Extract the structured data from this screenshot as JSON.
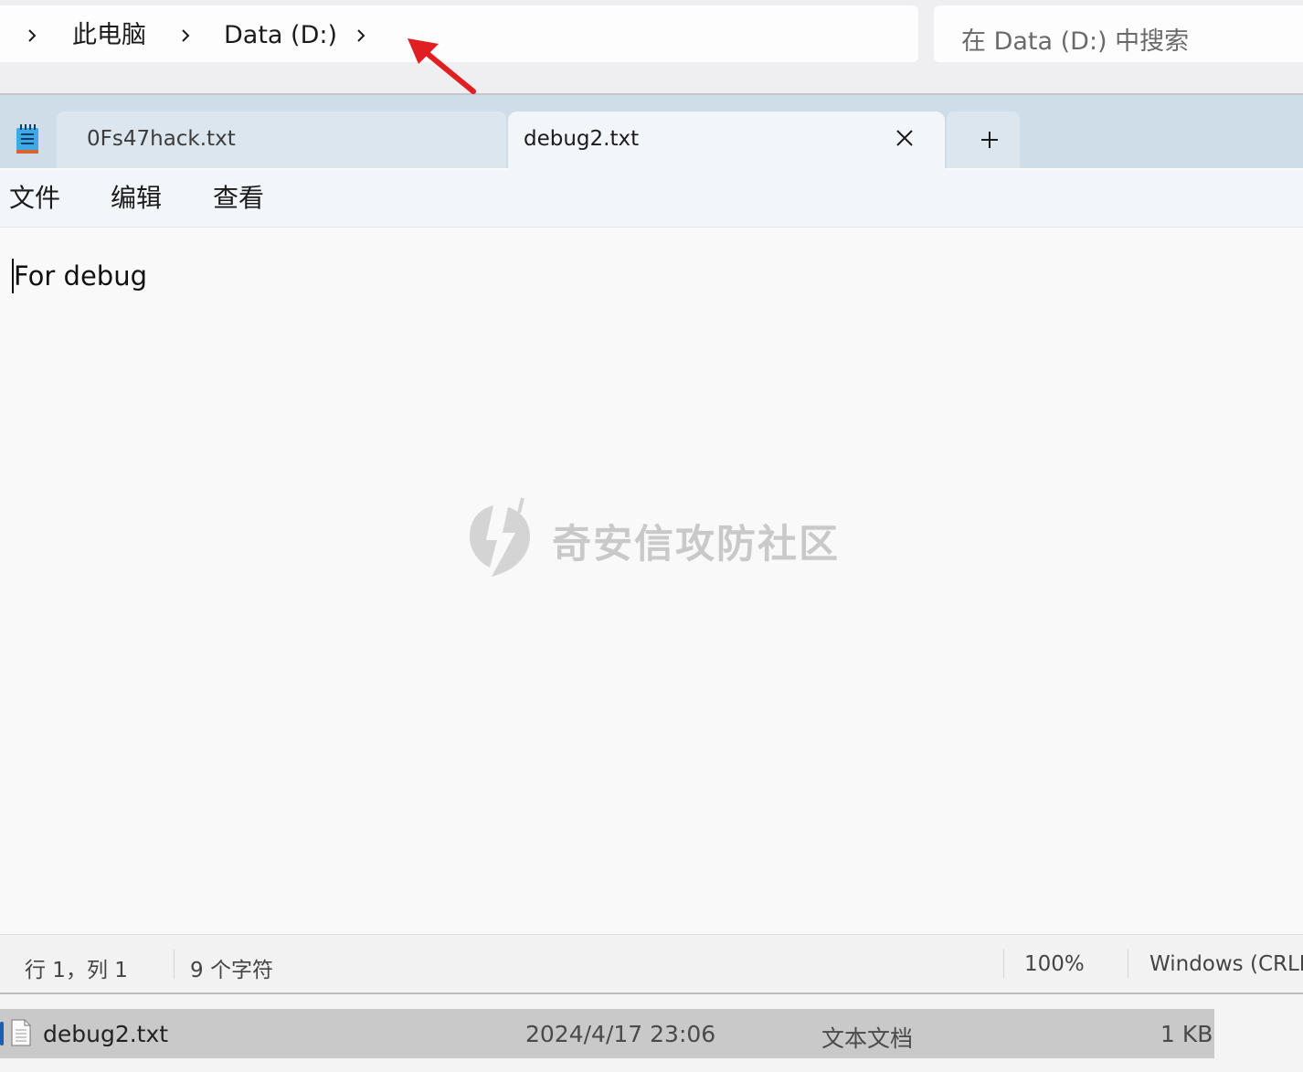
{
  "explorer": {
    "breadcrumb": [
      "此电脑",
      "Data (D:)"
    ],
    "search_placeholder": "在 Data (D:) 中搜索",
    "annotation_color": "#e02020"
  },
  "notepad": {
    "tabs": [
      {
        "label": "0Fs47hack.txt",
        "active": false
      },
      {
        "label": "debug2.txt",
        "active": true
      }
    ],
    "new_tab_icon": "plus-icon",
    "close_icon": "close-icon",
    "menu": [
      "文件",
      "编辑",
      "查看"
    ],
    "content": "For debug",
    "watermark": "奇安信攻防社区",
    "status": {
      "position": "行 1，列 1",
      "char_count": "9 个字符",
      "zoom": "100%",
      "line_ending": "Windows (CRLF"
    }
  },
  "file_row": {
    "name": "debug2.txt",
    "modified": "2024/4/17 23:06",
    "type": "文本文档",
    "size": "1 KB"
  }
}
